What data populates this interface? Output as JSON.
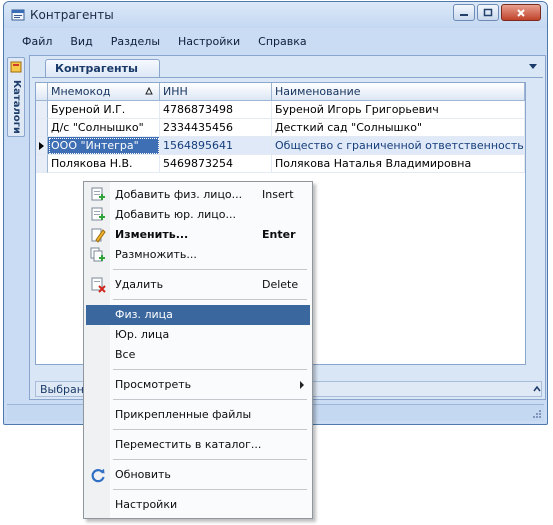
{
  "window": {
    "title": "Контрагенты"
  },
  "menubar": {
    "items": [
      "Файл",
      "Вид",
      "Разделы",
      "Настройки",
      "Справка"
    ]
  },
  "sidebar": {
    "tab_label": "Каталоги"
  },
  "document_tab": {
    "label": "Контрагенты"
  },
  "grid": {
    "columns": [
      "Мнемокод",
      "ИНН",
      "Наименование"
    ],
    "sorted_column": "Мнемокод",
    "rows": [
      {
        "mnemocode": "Буреной И.Г.",
        "inn": "4786873498",
        "name": "Буреной  Игорь Григорьевич"
      },
      {
        "mnemocode": "Д/с \"Солнышко\"",
        "inn": "2334435456",
        "name": "Десткий сад \"Солнышко\""
      },
      {
        "mnemocode": "ООО \"Интегра\"",
        "inn": "1564895641",
        "name": "Общество с граниченной ответственностью ..."
      },
      {
        "mnemocode": "Полякова Н.В.",
        "inn": "5469873254",
        "name": "Полякова Наталья Владимировна"
      }
    ],
    "selected_row": 2
  },
  "status": {
    "text": "Выбрано"
  },
  "context_menu": {
    "items": [
      {
        "label": "Добавить физ. лицо...",
        "shortcut": "Insert",
        "icon": "add-person-icon"
      },
      {
        "label": "Добавить юр. лицо...",
        "shortcut": "",
        "icon": "add-company-icon"
      },
      {
        "label": "Изменить...",
        "shortcut": "Enter",
        "icon": "edit-pencil-icon",
        "bold": true
      },
      {
        "label": "Размножить...",
        "shortcut": "",
        "icon": "duplicate-icon"
      },
      {
        "label": "Удалить",
        "shortcut": "Delete",
        "icon": "delete-icon"
      },
      {
        "label": "Физ. лица",
        "shortcut": "",
        "highlighted": true
      },
      {
        "label": "Юр. лица",
        "shortcut": ""
      },
      {
        "label": "Все",
        "shortcut": ""
      },
      {
        "label": "Просмотреть",
        "shortcut": "",
        "submenu": true
      },
      {
        "label": "Прикрепленные файлы",
        "shortcut": ""
      },
      {
        "label": "Переместить в каталог...",
        "shortcut": ""
      },
      {
        "label": "Обновить",
        "shortcut": "",
        "icon": "refresh-icon"
      },
      {
        "label": "Настройки",
        "shortcut": ""
      }
    ]
  },
  "colors": {
    "highlight": "#3a679e",
    "window_frame": "#c9dcf3",
    "selected_cell": "#3e6eb3"
  }
}
